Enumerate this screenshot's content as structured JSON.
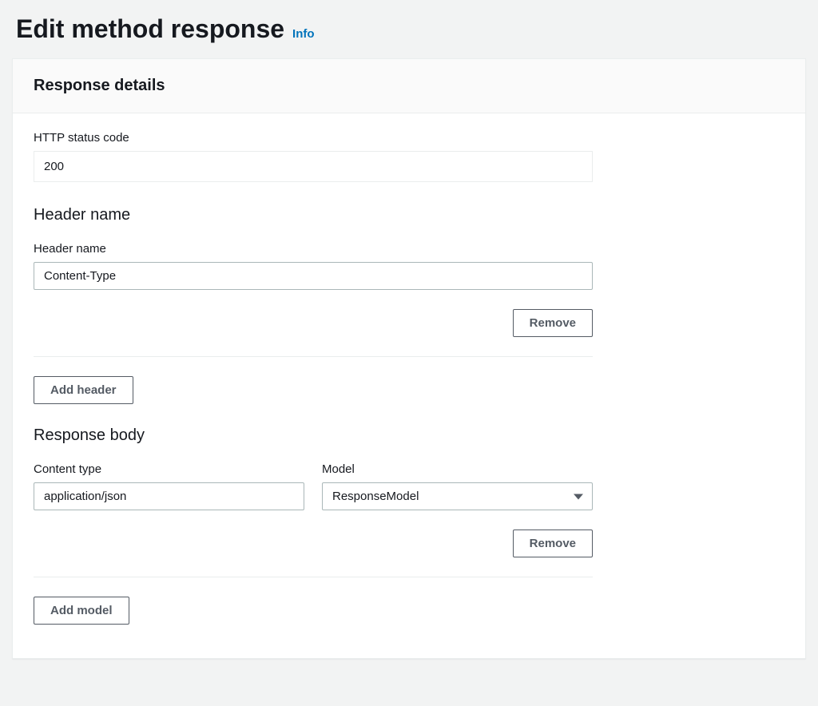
{
  "page": {
    "title": "Edit method response",
    "info_link": "Info"
  },
  "panel": {
    "title": "Response details"
  },
  "status_code": {
    "label": "HTTP status code",
    "value": "200"
  },
  "header_section": {
    "title": "Header name",
    "field_label": "Header name",
    "value": "Content-Type",
    "remove_label": "Remove",
    "add_label": "Add header"
  },
  "body_section": {
    "title": "Response body",
    "content_type_label": "Content type",
    "content_type_value": "application/json",
    "model_label": "Model",
    "model_value": "ResponseModel",
    "remove_label": "Remove",
    "add_label": "Add model"
  }
}
